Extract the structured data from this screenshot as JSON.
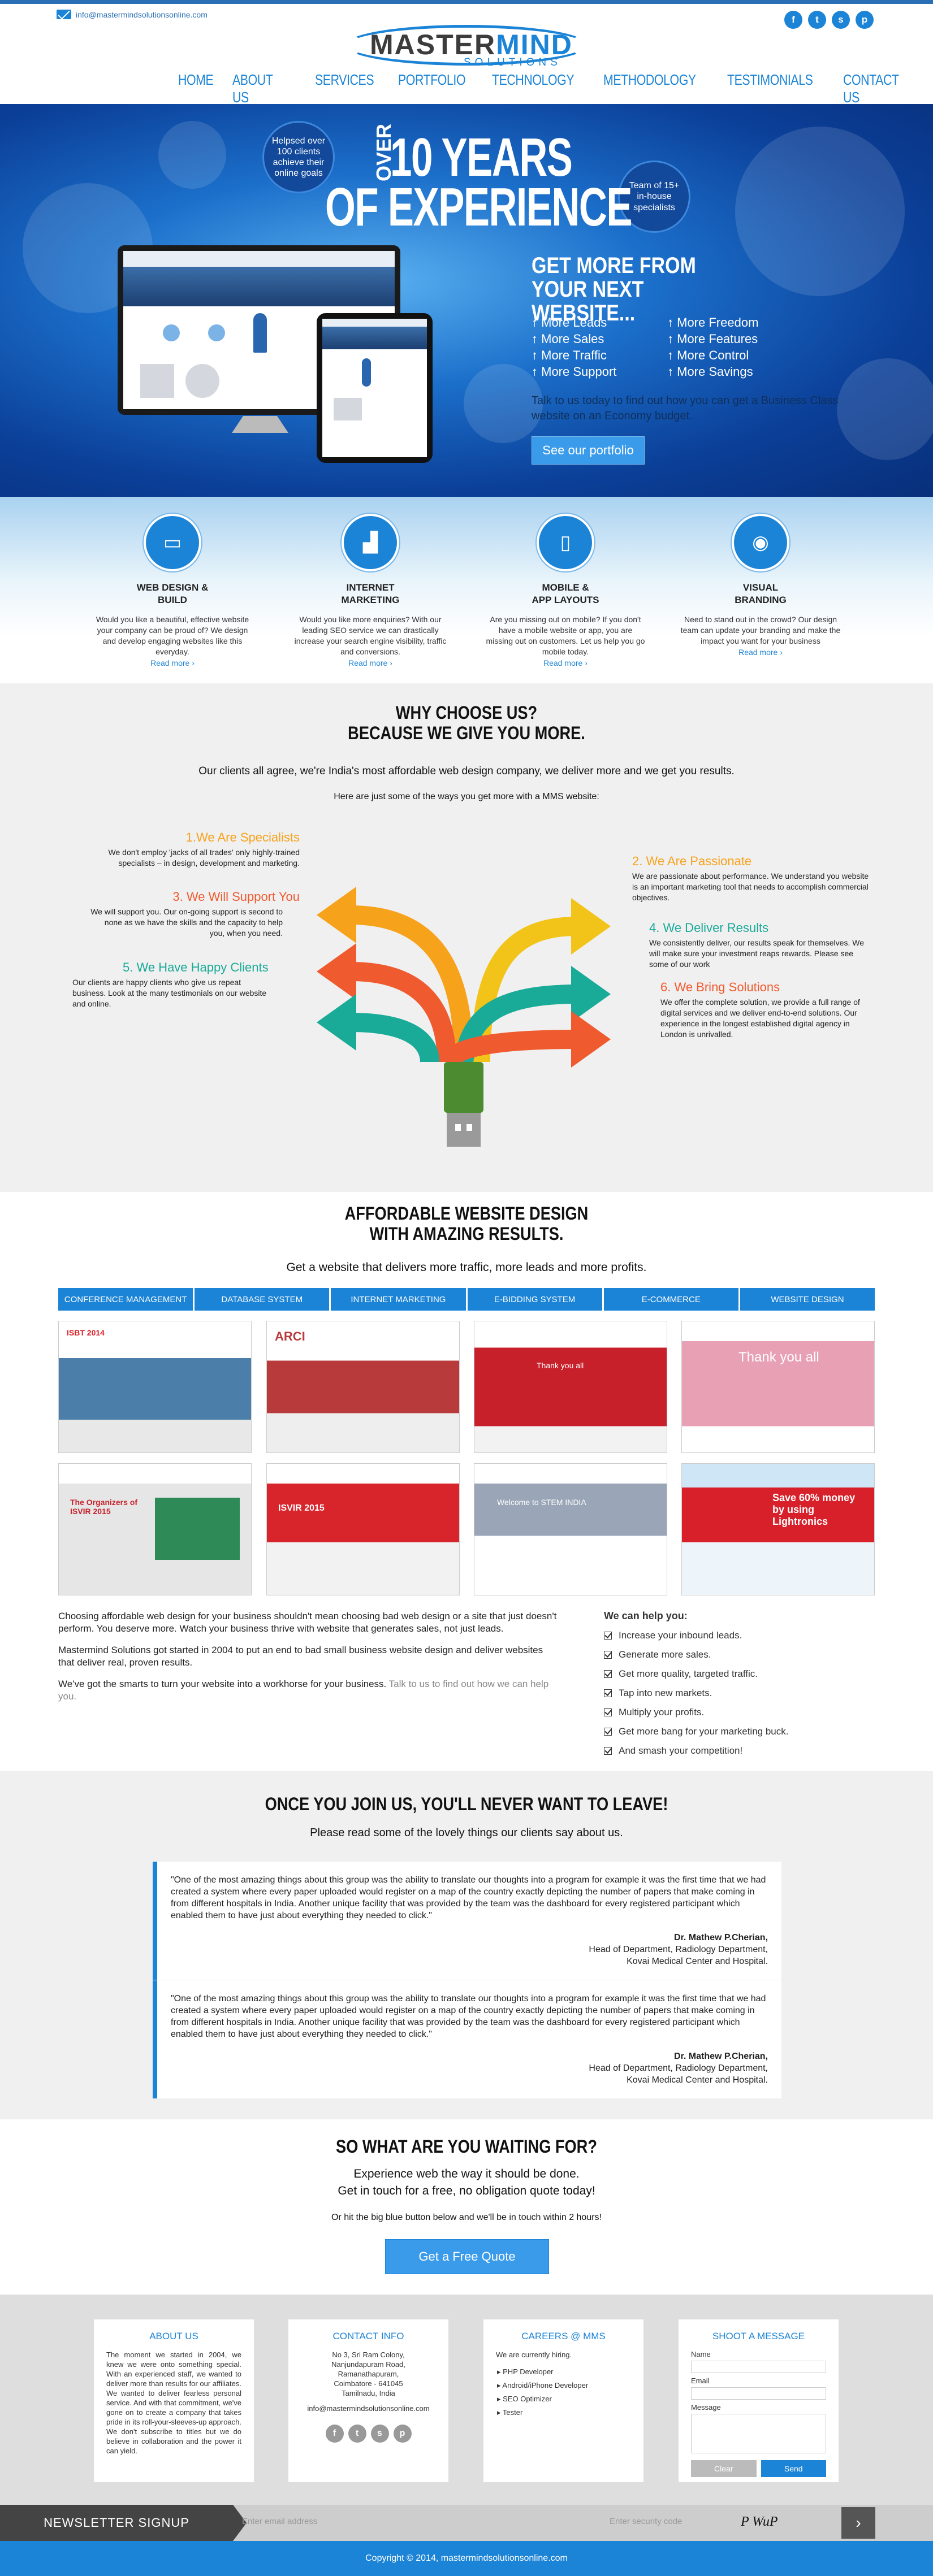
{
  "topbar": {
    "email": "info@mastermindsolutionsonline.com",
    "social": [
      "f",
      "t",
      "s",
      "p"
    ]
  },
  "logo": {
    "name_a": "MASTER",
    "name_b": "MIND",
    "tagline": "SOLUTIONS"
  },
  "nav": [
    "HOME",
    "ABOUT US",
    "SERVICES",
    "PORTFOLIO",
    "TECHNOLOGY",
    "METHODOLOGY",
    "TESTIMONIALS",
    "CONTACT US"
  ],
  "hero": {
    "badge_left": "Helpsed over 100 clients achieve their online goals",
    "badge_right": "Team of 15+ in-house specialists",
    "over": "OVER",
    "line1": "10 YEARS",
    "line2": "OF EXPERIENCE",
    "heading": "GET MORE FROM YOUR NEXT WEBSITE...",
    "bullets_left": [
      "More Leads",
      "More Sales",
      "More Traffic",
      "More Support"
    ],
    "bullets_right": [
      "More Freedom",
      "More Features",
      "More Control",
      "More Savings"
    ],
    "desc": "Talk to us today to find out how you can get a Business Class website on an Economy budget.",
    "button": "See our portfolio"
  },
  "services": [
    {
      "title1": "WEB DESIGN &",
      "title2": "BUILD",
      "text": "Would you like a beautiful, effective website your company can be proud of? We design and develop engaging websites like this everyday.",
      "more": "Read more"
    },
    {
      "title1": "INTERNET",
      "title2": "MARKETING",
      "text": "Would you like more enquiries? With our leading SEO service we can drastically increase your search engine visibility, traffic and conversions.",
      "more": "Read more"
    },
    {
      "title1": "MOBILE &",
      "title2": "APP LAYOUTS",
      "text": "Are you missing out on mobile? If you don't have a mobile website or app, you are missing out on customers. Let us help you go mobile today.",
      "more": "Read more"
    },
    {
      "title1": "VISUAL",
      "title2": "BRANDING",
      "text": "Need to stand out in the crowd? Our design team can update your branding and make the impact you want for your business",
      "more": "Read more"
    }
  ],
  "why": {
    "title1": "WHY CHOOSE US?",
    "title2": "BECAUSE WE GIVE YOU MORE.",
    "intro": "Our clients all agree, we're India's most affordable web design company, we deliver more and we get you results.",
    "sub": "Here are just some of the ways you get more with a MMS website:",
    "items": [
      {
        "h": "1.We Are Specialists",
        "t": "We don't employ 'jacks of all trades' only highly-trained specialists – in design, development and marketing."
      },
      {
        "h": "3. We Will Support You",
        "t": "We will support you. Our on-going support is second to none as we have the skills and the capacity to help you, when you need."
      },
      {
        "h": "5. We Have Happy Clients",
        "t": "Our clients are happy clients who give us repeat business. Look at the many testimonials on our website and online."
      },
      {
        "h": "2. We Are Passionate",
        "t": "We are passionate about performance. We understand you website is an important marketing tool that needs to accomplish commercial objectives."
      },
      {
        "h": "4. We Deliver Results",
        "t": "We consistently deliver, our results speak for themselves. We will make sure your investment reaps rewards. Please see some of our work"
      },
      {
        "h": "6. We Bring Solutions",
        "t": "We offer the complete solution, we provide a full range of digital services and we deliver end-to-end solutions. Our experience in the longest established digital agency in London is unrivalled."
      }
    ]
  },
  "portfolio": {
    "title1": "AFFORDABLE WEBSITE DESIGN",
    "title2": "WITH AMAZING RESULTS.",
    "sub": "Get a website that delivers more traffic, more leads and more profits.",
    "tabs": [
      "CONFERENCE MANAGEMENT",
      "DATABASE SYSTEM",
      "INTERNET MARKETING",
      "E-BIDDING SYSTEM",
      "E-COMMERCE",
      "WEBSITE DESIGN"
    ],
    "thumbs": [
      {
        "label": "ISBT 2014",
        "color": "#4b7ea8"
      },
      {
        "label": "ARCI",
        "color": "#b93a3a"
      },
      {
        "label": "Thank you all",
        "color": "#c8202a"
      },
      {
        "label": "Thank you all",
        "color": "#e8a0b4"
      },
      {
        "label": "The Organizers of ISVIR 2015",
        "color": "#2e8b57"
      },
      {
        "label": "ISVIR 2015",
        "color": "#d8252c"
      },
      {
        "label": "Welcome to STEM INDIA",
        "color": "#9aa6b8"
      },
      {
        "label": "Save 60% money by using Lightronics",
        "color": "#d8202a"
      }
    ],
    "para1": "Choosing affordable web design for your business shouldn't mean choosing bad web design or a site that just doesn't perform. You deserve more. Watch your business thrive with website that generates sales, not just leads.",
    "para2": "Mastermind Solutions got started in 2004 to put an end to bad small business website design and deliver websites that deliver real, proven results.",
    "para3a": "We've got the smarts to turn your website into a workhorse for your business. ",
    "para3b": "Talk to us to find out how we can help you.",
    "help_title": "We can help you:",
    "help_items": [
      "Increase your inbound leads.",
      "Generate more sales.",
      "Get more quality, targeted traffic.",
      "Tap into new markets.",
      "Multiply your profits.",
      "Get more bang for your marketing buck.",
      "And smash your competition!"
    ]
  },
  "testimonials": {
    "title": "ONCE YOU JOIN US, YOU'LL NEVER WANT TO LEAVE!",
    "sub": "Please read some of the lovely things our clients say about us.",
    "items": [
      {
        "quote": "\"One of the most amazing things about this group was the ability to translate our thoughts into a program for example it was the first time that we had created a system where every paper uploaded would register on a map of the country exactly depicting the number of papers that make coming in from different hospitals in India. Another unique facility that was provided by the team was the dashboard for every registered participant which enabled them to have just about everything they needed to click.\"",
        "name": "Dr. Mathew P.Cherian,",
        "role": "Head of Department, Radiology Department,",
        "org": "Kovai Medical Center and Hospital."
      },
      {
        "quote": "\"One of the most amazing things about this group was the ability to translate our thoughts into a program for example it was the first time that we had created a system where every paper uploaded would register on a map of the country exactly depicting the number of papers that make coming in from different hospitals in India. Another unique facility that was provided by the team was the dashboard for every registered participant which enabled them to have just about everything they needed to click.\"",
        "name": "Dr. Mathew P.Cherian,",
        "role": "Head of Department, Radiology Department,",
        "org": "Kovai Medical Center and Hospital."
      }
    ]
  },
  "wait": {
    "title": "SO WHAT ARE YOU WAITING FOR?",
    "line1": "Experience web the way it should be done.",
    "line2": "Get in touch for a free, no obligation quote today!",
    "line3": "Or hit the big blue button below and we'll be in touch within 2 hours!",
    "button": "Get a Free Quote"
  },
  "footer": {
    "about_title": "ABOUT US",
    "about_text": "The moment we started in 2004, we knew we were onto something special. With an experienced staff, we wanted to deliver more than results for our affiliates. We wanted to deliver fearless personal service. And with that commitment, we've gone on to create a company that takes pride in its roll-your-sleeves-up approach. We don't subscribe to titles but we do believe in collaboration and the power it can yield.",
    "contact_title": "CONTACT INFO",
    "address": [
      "No 3, Sri Ram Colony,",
      "Nanjundapuram Road,",
      "Ramanathapuram,",
      "Coimbatore - 641045",
      "Tamilnadu, India"
    ],
    "contact_email": "info@mastermindsolutionsonline.com",
    "careers_title": "CAREERS @ MMS",
    "careers_intro": "We are currently hiring.",
    "careers": [
      "PHP Developer",
      "Android/iPhone Developer",
      "SEO Optimizer",
      "Tester"
    ],
    "msg_title": "SHOOT A MESSAGE",
    "f_name": "Name",
    "f_email": "Email",
    "f_message": "Message",
    "clear": "Clear",
    "send": "Send"
  },
  "newsletter": {
    "label": "NEWSLETTER SIGNUP",
    "email_ph": "Enter email address",
    "code_ph": "Enter security code",
    "captcha": "P WuP",
    "go": "›"
  },
  "copyright": "Copyright © 2014, mastermindsolutionsonline.com"
}
